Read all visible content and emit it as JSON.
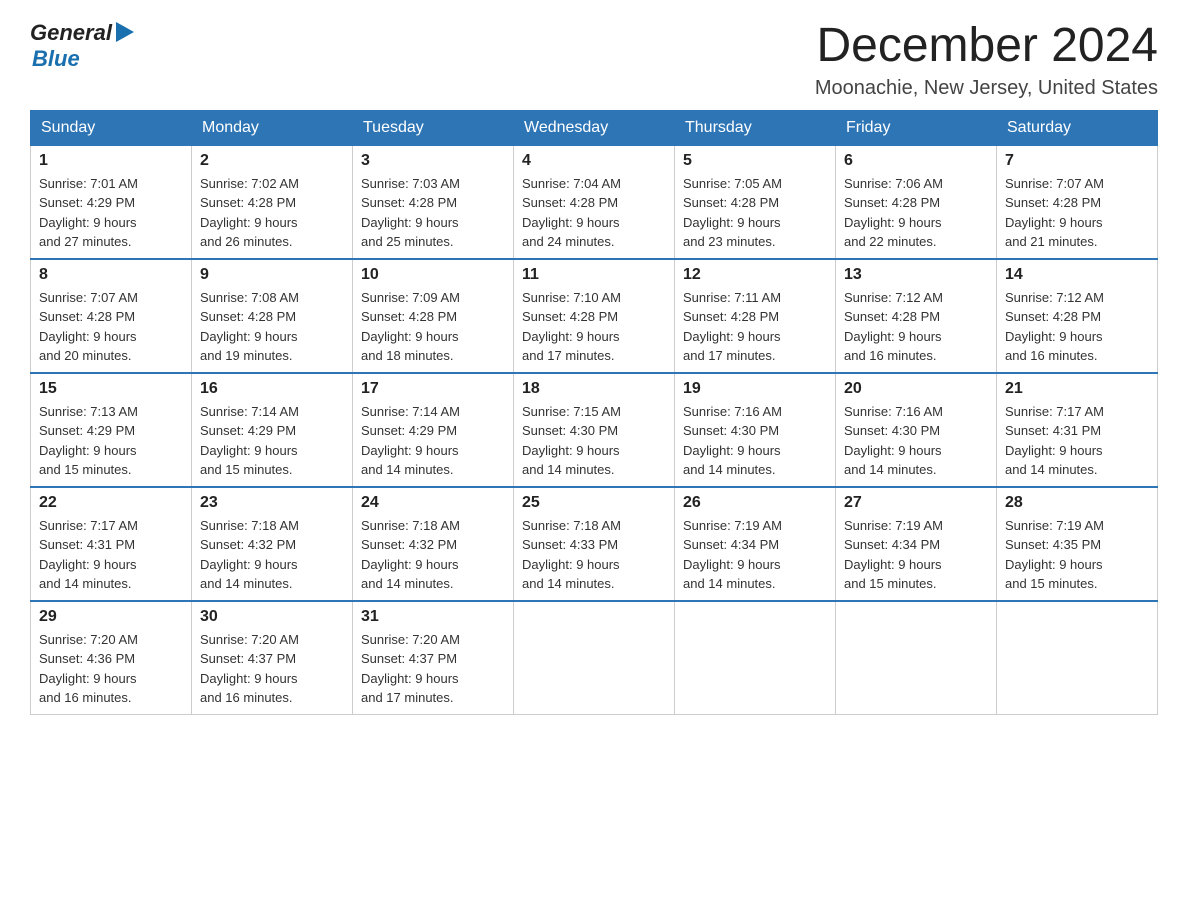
{
  "header": {
    "logo_general": "General",
    "logo_blue": "Blue",
    "month_year": "December 2024",
    "location": "Moonachie, New Jersey, United States"
  },
  "days_of_week": [
    "Sunday",
    "Monday",
    "Tuesday",
    "Wednesday",
    "Thursday",
    "Friday",
    "Saturday"
  ],
  "weeks": [
    [
      {
        "day": "1",
        "sunrise": "7:01 AM",
        "sunset": "4:29 PM",
        "daylight": "9 hours and 27 minutes."
      },
      {
        "day": "2",
        "sunrise": "7:02 AM",
        "sunset": "4:28 PM",
        "daylight": "9 hours and 26 minutes."
      },
      {
        "day": "3",
        "sunrise": "7:03 AM",
        "sunset": "4:28 PM",
        "daylight": "9 hours and 25 minutes."
      },
      {
        "day": "4",
        "sunrise": "7:04 AM",
        "sunset": "4:28 PM",
        "daylight": "9 hours and 24 minutes."
      },
      {
        "day": "5",
        "sunrise": "7:05 AM",
        "sunset": "4:28 PM",
        "daylight": "9 hours and 23 minutes."
      },
      {
        "day": "6",
        "sunrise": "7:06 AM",
        "sunset": "4:28 PM",
        "daylight": "9 hours and 22 minutes."
      },
      {
        "day": "7",
        "sunrise": "7:07 AM",
        "sunset": "4:28 PM",
        "daylight": "9 hours and 21 minutes."
      }
    ],
    [
      {
        "day": "8",
        "sunrise": "7:07 AM",
        "sunset": "4:28 PM",
        "daylight": "9 hours and 20 minutes."
      },
      {
        "day": "9",
        "sunrise": "7:08 AM",
        "sunset": "4:28 PM",
        "daylight": "9 hours and 19 minutes."
      },
      {
        "day": "10",
        "sunrise": "7:09 AM",
        "sunset": "4:28 PM",
        "daylight": "9 hours and 18 minutes."
      },
      {
        "day": "11",
        "sunrise": "7:10 AM",
        "sunset": "4:28 PM",
        "daylight": "9 hours and 17 minutes."
      },
      {
        "day": "12",
        "sunrise": "7:11 AM",
        "sunset": "4:28 PM",
        "daylight": "9 hours and 17 minutes."
      },
      {
        "day": "13",
        "sunrise": "7:12 AM",
        "sunset": "4:28 PM",
        "daylight": "9 hours and 16 minutes."
      },
      {
        "day": "14",
        "sunrise": "7:12 AM",
        "sunset": "4:28 PM",
        "daylight": "9 hours and 16 minutes."
      }
    ],
    [
      {
        "day": "15",
        "sunrise": "7:13 AM",
        "sunset": "4:29 PM",
        "daylight": "9 hours and 15 minutes."
      },
      {
        "day": "16",
        "sunrise": "7:14 AM",
        "sunset": "4:29 PM",
        "daylight": "9 hours and 15 minutes."
      },
      {
        "day": "17",
        "sunrise": "7:14 AM",
        "sunset": "4:29 PM",
        "daylight": "9 hours and 14 minutes."
      },
      {
        "day": "18",
        "sunrise": "7:15 AM",
        "sunset": "4:30 PM",
        "daylight": "9 hours and 14 minutes."
      },
      {
        "day": "19",
        "sunrise": "7:16 AM",
        "sunset": "4:30 PM",
        "daylight": "9 hours and 14 minutes."
      },
      {
        "day": "20",
        "sunrise": "7:16 AM",
        "sunset": "4:30 PM",
        "daylight": "9 hours and 14 minutes."
      },
      {
        "day": "21",
        "sunrise": "7:17 AM",
        "sunset": "4:31 PM",
        "daylight": "9 hours and 14 minutes."
      }
    ],
    [
      {
        "day": "22",
        "sunrise": "7:17 AM",
        "sunset": "4:31 PM",
        "daylight": "9 hours and 14 minutes."
      },
      {
        "day": "23",
        "sunrise": "7:18 AM",
        "sunset": "4:32 PM",
        "daylight": "9 hours and 14 minutes."
      },
      {
        "day": "24",
        "sunrise": "7:18 AM",
        "sunset": "4:32 PM",
        "daylight": "9 hours and 14 minutes."
      },
      {
        "day": "25",
        "sunrise": "7:18 AM",
        "sunset": "4:33 PM",
        "daylight": "9 hours and 14 minutes."
      },
      {
        "day": "26",
        "sunrise": "7:19 AM",
        "sunset": "4:34 PM",
        "daylight": "9 hours and 14 minutes."
      },
      {
        "day": "27",
        "sunrise": "7:19 AM",
        "sunset": "4:34 PM",
        "daylight": "9 hours and 15 minutes."
      },
      {
        "day": "28",
        "sunrise": "7:19 AM",
        "sunset": "4:35 PM",
        "daylight": "9 hours and 15 minutes."
      }
    ],
    [
      {
        "day": "29",
        "sunrise": "7:20 AM",
        "sunset": "4:36 PM",
        "daylight": "9 hours and 16 minutes."
      },
      {
        "day": "30",
        "sunrise": "7:20 AM",
        "sunset": "4:37 PM",
        "daylight": "9 hours and 16 minutes."
      },
      {
        "day": "31",
        "sunrise": "7:20 AM",
        "sunset": "4:37 PM",
        "daylight": "9 hours and 17 minutes."
      },
      null,
      null,
      null,
      null
    ]
  ],
  "labels": {
    "sunrise": "Sunrise:",
    "sunset": "Sunset:",
    "daylight": "Daylight:"
  }
}
